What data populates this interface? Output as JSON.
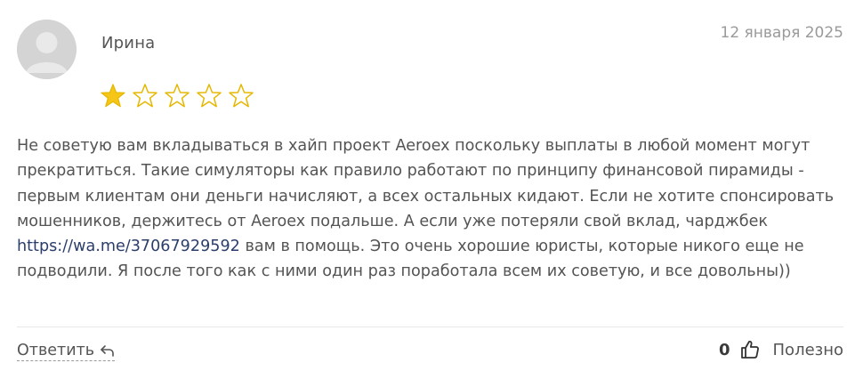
{
  "review": {
    "author": "Ирина",
    "date": "12 января 2025",
    "rating": 1,
    "rating_max": 5,
    "text_before_link": "Не советую вам вкладываться в хайп проект Aeroex поскольку выплаты в любой момент могут прекратиться. Такие симуляторы как правило работают по принципу финансовой пирамиды - первым клиентам они деньги начисляют, а всех остальных кидают. Если не хотите спонсировать мошенников, держитесь от Aeroex подальше. А если уже потеряли свой вклад, чарджбек ",
    "link_text": "https://wa.me/37067929592",
    "text_after_link": " вам в помощь. Это очень хорошие юристы, которые никого еще не подводили. Я после того как с ними один раз поработала всем их советую, и все довольны))"
  },
  "actions": {
    "reply_label": "Ответить",
    "helpful_count": "0",
    "helpful_label": "Полезно"
  },
  "colors": {
    "star_filled": "#f5c518",
    "star_empty_outline": "#e5b700",
    "link": "#2b3e6b"
  },
  "icons": {
    "avatar": "user-avatar-placeholder",
    "star": "star-icon",
    "reply": "reply-arrow-icon",
    "thumb": "thumbs-up-icon"
  }
}
